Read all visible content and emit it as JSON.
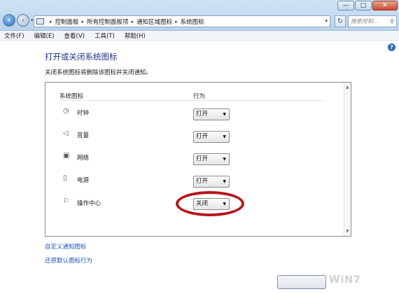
{
  "window": {
    "minimize": "—",
    "maximize": "□",
    "close": "✕"
  },
  "address": {
    "crumbs": [
      "控制面板",
      "所有控制面板项",
      "通知区域图标",
      "系统图标"
    ],
    "refresh_icon": "refresh-icon",
    "search_placeholder": "搜索控制..."
  },
  "menu": [
    "文件(F)",
    "编辑(E)",
    "查看(V)",
    "工具(T)",
    "帮助(H)"
  ],
  "page": {
    "title": "打开或关闭系统图标",
    "subtitle": "关闭系统图标将删除该图标并关闭通知。",
    "help": "?"
  },
  "table": {
    "col_icon": "系统图标",
    "col_behavior": "行为",
    "rows": [
      {
        "label": "时钟",
        "icon": "clock-icon",
        "glyph": "◷",
        "value": "打开"
      },
      {
        "label": "音量",
        "icon": "volume-icon",
        "glyph": "◁",
        "value": "打开"
      },
      {
        "label": "网络",
        "icon": "network-icon",
        "glyph": "▣",
        "value": "打开"
      },
      {
        "label": "电源",
        "icon": "power-icon",
        "glyph": "▯",
        "value": "打开"
      },
      {
        "label": "操作中心",
        "icon": "action-center-flag-icon",
        "glyph": "⚐",
        "value": "关闭"
      }
    ]
  },
  "links": {
    "customize": "自定义通知图标",
    "restore": "还原默认图标行为"
  },
  "colors": {
    "title": "#1e3287",
    "link": "#1a56b6",
    "highlight": "#b8151b"
  }
}
